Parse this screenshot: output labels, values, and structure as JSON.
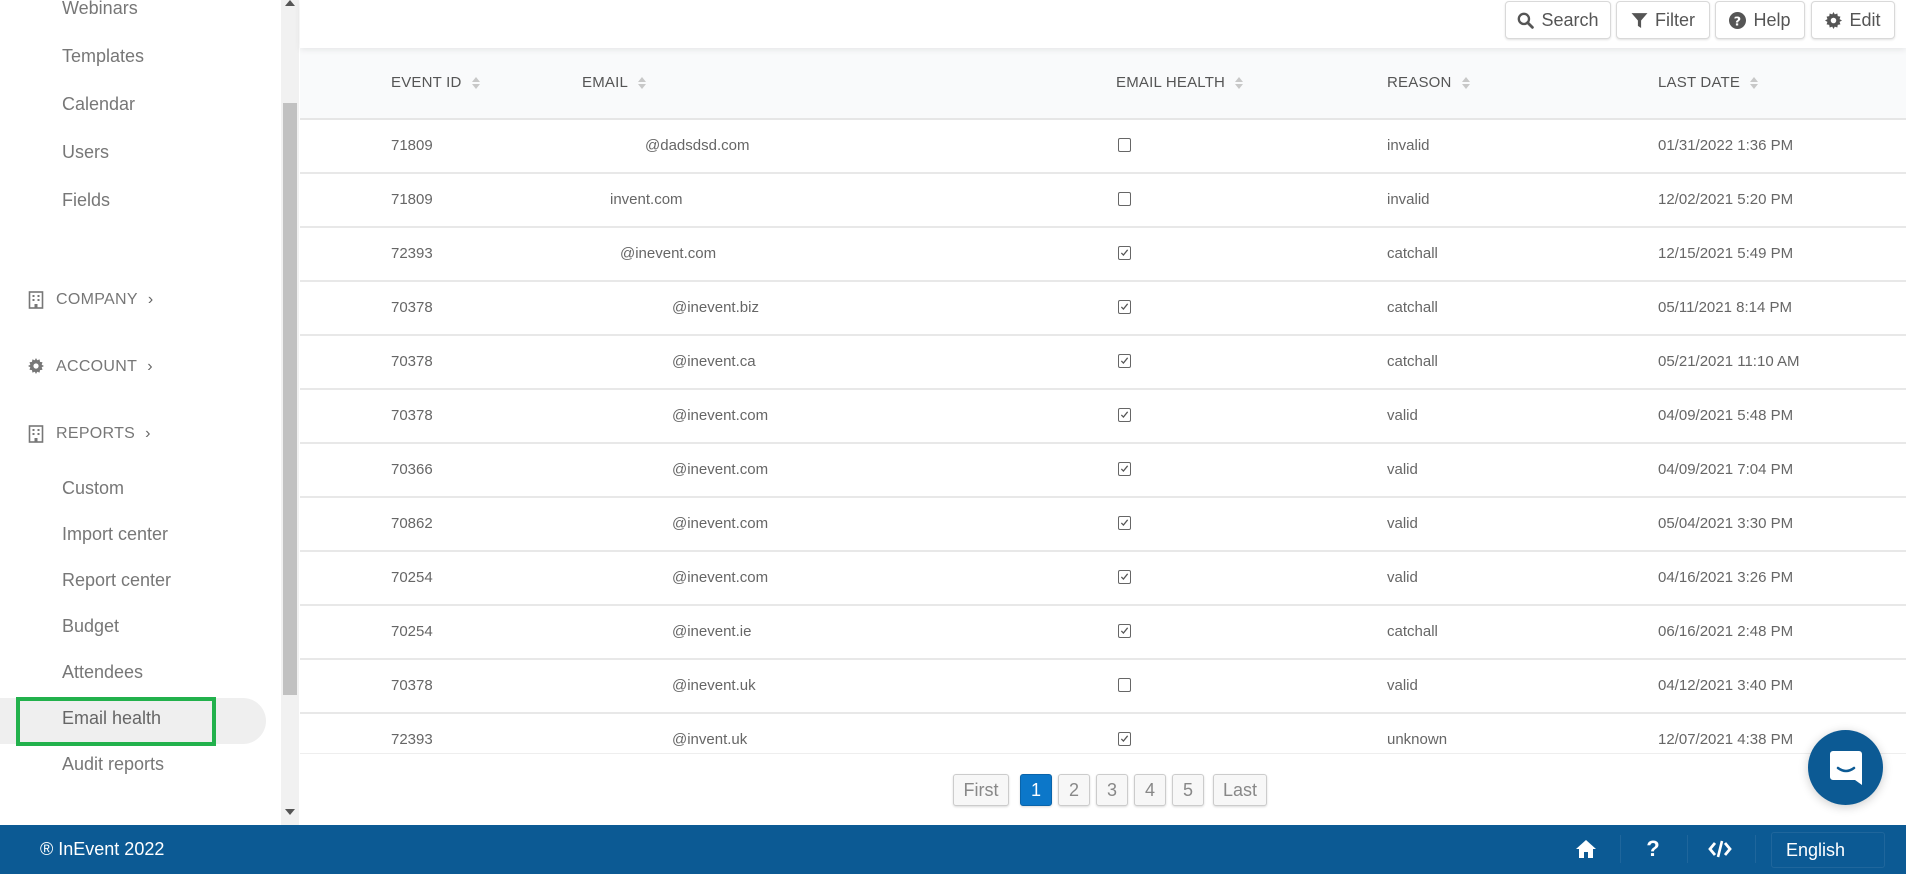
{
  "sidebar": {
    "items_top": [
      {
        "label": "Webinars"
      },
      {
        "label": "Templates"
      },
      {
        "label": "Calendar"
      },
      {
        "label": "Users"
      },
      {
        "label": "Fields"
      }
    ],
    "sections": [
      {
        "label": "COMPANY",
        "icon": "building-icon"
      },
      {
        "label": "ACCOUNT",
        "icon": "gear-icon"
      },
      {
        "label": "REPORTS",
        "icon": "building-icon"
      }
    ],
    "report_items": [
      {
        "label": "Custom"
      },
      {
        "label": "Import center"
      },
      {
        "label": "Report center"
      },
      {
        "label": "Budget"
      },
      {
        "label": "Attendees"
      },
      {
        "label": "Email health",
        "active": true
      },
      {
        "label": "Audit reports"
      }
    ]
  },
  "toolbar": {
    "search_label": "Search",
    "filter_label": "Filter",
    "help_label": "Help",
    "edit_label": "Edit"
  },
  "table": {
    "columns": [
      "EVENT ID",
      "EMAIL",
      "EMAIL HEALTH",
      "REASON",
      "LAST DATE"
    ],
    "rows": [
      {
        "event_id": "71809",
        "email": "@dadsdsd.com",
        "healthy": false,
        "reason": "invalid",
        "last_date": "01/31/2022 1:36 PM"
      },
      {
        "event_id": "71809",
        "email": "invent.com",
        "healthy": false,
        "reason": "invalid",
        "last_date": "12/02/2021 5:20 PM"
      },
      {
        "event_id": "72393",
        "email": "@inevent.com",
        "healthy": true,
        "reason": "catchall",
        "last_date": "12/15/2021 5:49 PM"
      },
      {
        "event_id": "70378",
        "email": "@inevent.biz",
        "healthy": true,
        "reason": "catchall",
        "last_date": "05/11/2021 8:14 PM"
      },
      {
        "event_id": "70378",
        "email": "@inevent.ca",
        "healthy": true,
        "reason": "catchall",
        "last_date": "05/21/2021 11:10 AM"
      },
      {
        "event_id": "70378",
        "email": "@inevent.com",
        "healthy": true,
        "reason": "valid",
        "last_date": "04/09/2021 5:48 PM"
      },
      {
        "event_id": "70366",
        "email": "@inevent.com",
        "healthy": true,
        "reason": "valid",
        "last_date": "04/09/2021 7:04 PM"
      },
      {
        "event_id": "70862",
        "email": "@inevent.com",
        "healthy": true,
        "reason": "valid",
        "last_date": "05/04/2021 3:30 PM"
      },
      {
        "event_id": "70254",
        "email": "@inevent.com",
        "healthy": true,
        "reason": "valid",
        "last_date": "04/16/2021 3:26 PM"
      },
      {
        "event_id": "70254",
        "email": "@inevent.ie",
        "healthy": true,
        "reason": "catchall",
        "last_date": "06/16/2021 2:48 PM"
      },
      {
        "event_id": "70378",
        "email": "@inevent.uk",
        "healthy": false,
        "reason": "valid",
        "last_date": "04/12/2021 3:40 PM"
      },
      {
        "event_id": "72393",
        "email": "@invent.uk",
        "healthy": true,
        "reason": "unknown",
        "last_date": "12/07/2021 4:38 PM"
      }
    ]
  },
  "pagination": {
    "first_label": "First",
    "last_label": "Last",
    "pages": [
      "1",
      "2",
      "3",
      "4",
      "5"
    ],
    "current_page": "1"
  },
  "footer": {
    "copyright": "® InEvent 2022",
    "language": "English",
    "icons": [
      "home-icon",
      "question-icon",
      "code-icon"
    ]
  },
  "colors": {
    "brand": "#0c5a94",
    "active_page": "#0c77c9",
    "highlight_box": "#22b14c"
  }
}
